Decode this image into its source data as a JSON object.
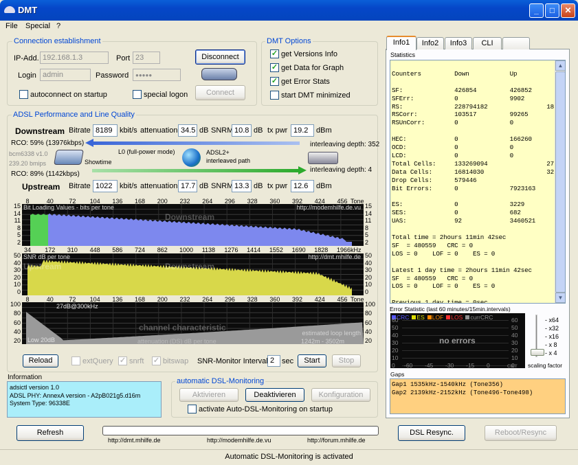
{
  "window": {
    "title": "DMT"
  },
  "menu": [
    "File",
    "Special",
    "?"
  ],
  "conn": {
    "legend": "Connection establishment",
    "ip_label": "IP-Add.",
    "ip": "192.168.1.3",
    "port_label": "Port",
    "port": "23",
    "login_label": "Login",
    "login": "admin",
    "pw_label": "Password",
    "pw": "●●●●●",
    "disconnect": "Disconnect",
    "connect": "Connect",
    "autoconnect": "autoconnect on startup",
    "special_logon": "special logon"
  },
  "opts": {
    "legend": "DMT Options",
    "items": [
      "get Versions Info",
      "get Data for Graph",
      "get Error Stats",
      "start DMT minimized"
    ]
  },
  "perf": {
    "legend": "ADSL Performance and Line Quality",
    "down": {
      "label": "Downstream",
      "bitrate_label": "Bitrate",
      "bitrate": "8189",
      "bitrate_unit": "kbit/s",
      "att_label": "attenuation",
      "att": "34.5",
      "att_unit": "dB",
      "snrm_label": "SNRM",
      "snrm": "10.8",
      "snrm_unit": "dB",
      "txpwr_label": "tx pwr",
      "txpwr": "19.2",
      "txpwr_unit": "dBm"
    },
    "up": {
      "label": "Upstream",
      "bitrate_label": "Bitrate",
      "bitrate": "1022",
      "bitrate_unit": "kbit/s",
      "att_label": "attenuation",
      "att": "17.7",
      "att_unit": "dB",
      "snrm_label": "SNRM",
      "snrm": "13.3",
      "snrm_unit": "dB",
      "txpwr_label": "tx pwr",
      "txpwr": "12.6",
      "txpwr_unit": "dBm"
    },
    "rco_down": "RCO: 59% (13976kbps)",
    "modem": "bcm6338 v1.0",
    "modem_rate": "239.20 bmips",
    "showtime": "Showtime",
    "l0": "L0 (full-power mode)",
    "adsl_mode": "ADSL2+",
    "interleaved": "interleaved path",
    "il_down": "interleaving depth: 352",
    "il_up": "interleaving depth: 4",
    "rco_up": "RCO: 89% (1142kbps)"
  },
  "charts": {
    "tones": [
      "8",
      "40",
      "72",
      "104",
      "136",
      "168",
      "200",
      "232",
      "264",
      "296",
      "328",
      "360",
      "392",
      "424",
      "456"
    ],
    "tone_label": "Tone",
    "khz": [
      "34",
      "172",
      "310",
      "448",
      "586",
      "724",
      "862",
      "1000",
      "1138",
      "1276",
      "1414",
      "1552",
      "1690",
      "1828",
      "1966"
    ],
    "khz_label": "kHz",
    "bits": {
      "title": "Bit Loading Values - bits per tone",
      "url": "http://modemhilfe.de.vu",
      "watermark": "Downstream",
      "yticks": [
        "15",
        "14",
        "11",
        "8",
        "5",
        "2"
      ]
    },
    "snr": {
      "title": "SNR  dB per tone",
      "url": "http://dmt.mhilfe.de",
      "wm1": "Upstream",
      "wm2": "Downstream",
      "yticks": [
        "50",
        "40",
        "30",
        "20",
        "10",
        "0"
      ]
    },
    "loop": {
      "label_top": "27dB@300kHz",
      "wm": "channel characteristic",
      "wm2": "attenuation (DS)  dB per tone",
      "label_low": "Low 20dB",
      "est": "estimated loop length",
      "est2": "1242m - 3502m",
      "yticks": [
        "100",
        "80",
        "60",
        "40",
        "20"
      ]
    }
  },
  "ctrl": {
    "reload": "Reload",
    "extquery": "extQuery",
    "snrft": "snrft",
    "bitswap": "bitswap",
    "snr_label": "SNR-Monitor Interval:",
    "snr_val": "2",
    "sec": "sec",
    "start": "Start",
    "stop": "Stop"
  },
  "info": {
    "title": "Information",
    "lines": [
      "adsictl version 1.0",
      "ADSL PHY: AnnexA version - A2pB021g5.d16m",
      "System Type: 96338E"
    ]
  },
  "auto": {
    "legend": "automatic DSL-Monitoring",
    "activate": "Aktivieren",
    "deactivate": "Deaktivieren",
    "config": "Konfiguration",
    "startup": "activate Auto-DSL-Monitoring on startup"
  },
  "bottom": {
    "refresh": "Refresh",
    "resync": "DSL Resync.",
    "reboot": "Reboot/Resync",
    "links": [
      "http://dmt.mhilfe.de",
      "http://modemhilfe.de.vu",
      "http://forum.mhilfe.de"
    ]
  },
  "status": "Automatic DSL-Monitoring is activated",
  "tabs": [
    "Info1",
    "Info2",
    "Info3",
    "CLI",
    ""
  ],
  "stats": {
    "title": "Statistics",
    "text": "\nCounters         Down           Up\n\nSF:              426854         426852\nSFErr:           0              9902\nRS:              228794182                1814121\nRSCorr:          103517         99265\nRSUnCorr:        0              0\n\nHEC:             0              166260\nOCD:             0              0\nLCD:             0              0\nTotal Cells:     133269094                2795688\nData Cells:      16814030                 3271790\nDrop Cells:      579446\nBit Errors:      0              7923163\n\nES:              0              3229\nSES:             0              682\nUAS:             92             3460521\n\nTotal time = 2hours 11min 42sec\nSF  = 480559   CRC = 0\nLOS = 0    LOF = 0    ES = 0\n\nLatest 1 day time = 2hours 11min 42sec\nSF  = 480559   CRC = 0\nLOS = 0    LOF = 0    ES = 0\n\nPrevious 1 day time = 0sec"
  },
  "errstat": {
    "title": "Error Statistic (last 60 minutes/15min.intervals)",
    "legend": [
      "CRC",
      "ES",
      "LOF",
      "LOS",
      "currCRC"
    ],
    "colors": [
      "#5555ff",
      "#dddd00",
      "#ff8800",
      "#ff3030",
      "#909090"
    ],
    "no_errors": "no errors",
    "yticks": [
      "60",
      "50",
      "40",
      "30",
      "20",
      "10",
      "0"
    ],
    "xticks": [
      "-60",
      "-45",
      "-30",
      "-15",
      "0",
      "curr"
    ],
    "scales": [
      "x64",
      "x32",
      "x16",
      "x 8",
      "x 4"
    ],
    "scaling": "scaling factor"
  },
  "gaps": {
    "title": "Gaps",
    "lines": [
      "Gap1 1535kHz-1540kHz (Tone356)",
      "Gap2 2139kHz-2152kHz (Tone496-Tone498)"
    ]
  }
}
